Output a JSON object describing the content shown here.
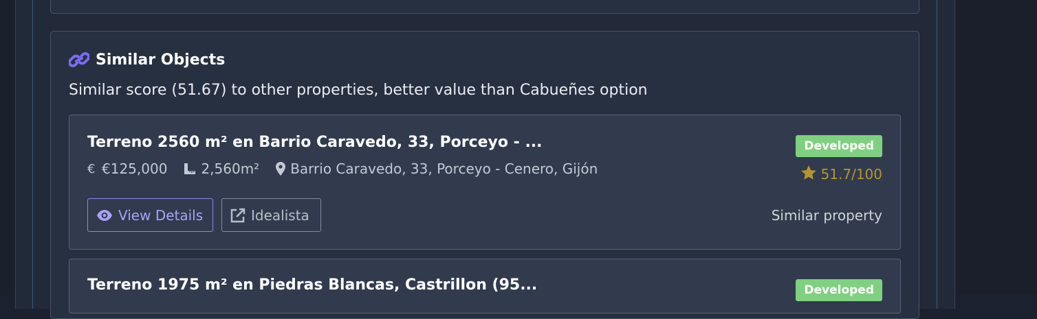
{
  "section": {
    "title": "Similar Objects",
    "title_icon": "link-icon",
    "summary": "Similar score (51.67) to other properties, better value than Cabueñes option"
  },
  "properties": [
    {
      "title": "Terreno 2560 m² en Barrio Caravedo, 33, Porceyo - ...",
      "price": "€125,000",
      "area": "2,560m²",
      "location": "Barrio Caravedo, 33, Porceyo - Cenero, Gijón",
      "status": "Developed",
      "score": "51.7/100",
      "note": "Similar property",
      "view_label": "View Details",
      "idealista_label": "Idealista"
    },
    {
      "title": "Terreno 1975 m² en Piedras Blancas, Castrillon (95...",
      "status": "Developed"
    }
  ],
  "colors": {
    "background": "#222a3a",
    "card": "#313b4d",
    "badge": "#7fd17f",
    "score": "#b5952e",
    "accent": "#8d85f2"
  }
}
